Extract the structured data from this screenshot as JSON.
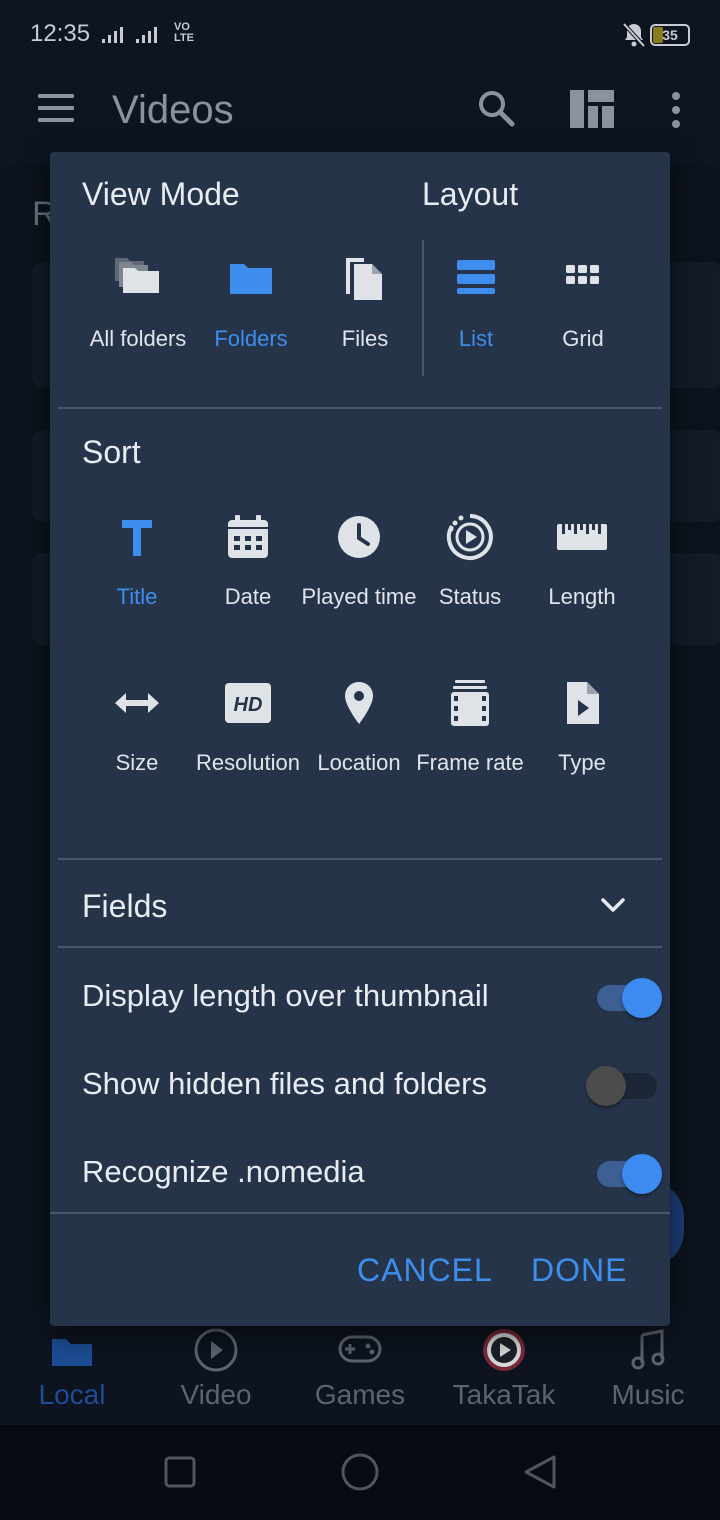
{
  "status_bar": {
    "time": "12:35",
    "network_label": "VO LTE",
    "battery": "35"
  },
  "app_bar": {
    "title": "Videos",
    "icons": [
      "menu-icon",
      "search-icon",
      "layout-icon",
      "more-vert-icon"
    ]
  },
  "background": {
    "section_letter": "R"
  },
  "dialog": {
    "view_mode": {
      "title": "View Mode",
      "options": [
        {
          "label": "All folders",
          "icon": "all-folders-icon",
          "selected": false
        },
        {
          "label": "Folders",
          "icon": "folder-icon",
          "selected": true
        },
        {
          "label": "Files",
          "icon": "files-icon",
          "selected": false
        }
      ]
    },
    "layout": {
      "title": "Layout",
      "options": [
        {
          "label": "List",
          "icon": "list-icon",
          "selected": true
        },
        {
          "label": "Grid",
          "icon": "grid-icon",
          "selected": false
        }
      ]
    },
    "sort": {
      "title": "Sort",
      "options": [
        {
          "label": "Title",
          "icon": "title-icon",
          "selected": true
        },
        {
          "label": "Date",
          "icon": "calendar-icon",
          "selected": false
        },
        {
          "label": "Played time",
          "icon": "clock-icon",
          "selected": false
        },
        {
          "label": "Status",
          "icon": "status-icon",
          "selected": false
        },
        {
          "label": "Length",
          "icon": "ruler-icon",
          "selected": false
        },
        {
          "label": "Size",
          "icon": "size-arrows-icon",
          "selected": false
        },
        {
          "label": "Resolution",
          "icon": "hd-icon",
          "selected": false
        },
        {
          "label": "Location",
          "icon": "location-pin-icon",
          "selected": false
        },
        {
          "label": "Frame rate",
          "icon": "film-icon",
          "selected": false
        },
        {
          "label": "Type",
          "icon": "file-type-icon",
          "selected": false
        }
      ]
    },
    "fields": {
      "title": "Fields"
    },
    "toggles": [
      {
        "label": "Display length over thumbnail",
        "on": true
      },
      {
        "label": "Show hidden files and folders",
        "on": false
      },
      {
        "label": "Recognize .nomedia",
        "on": true
      }
    ],
    "cancel_label": "CANCEL",
    "done_label": "DONE"
  },
  "bottom_nav": [
    {
      "label": "Local",
      "icon": "folder-icon",
      "active": true
    },
    {
      "label": "Video",
      "icon": "play-circle-icon",
      "active": false
    },
    {
      "label": "Games",
      "icon": "gamepad-icon",
      "active": false
    },
    {
      "label": "TakaTak",
      "icon": "takatak-icon",
      "active": false
    },
    {
      "label": "Music",
      "icon": "music-note-icon",
      "active": false
    }
  ],
  "colors": {
    "accent": "#3e8eed",
    "dialog_bg": "#26344a",
    "text": "#e8ecf1"
  }
}
